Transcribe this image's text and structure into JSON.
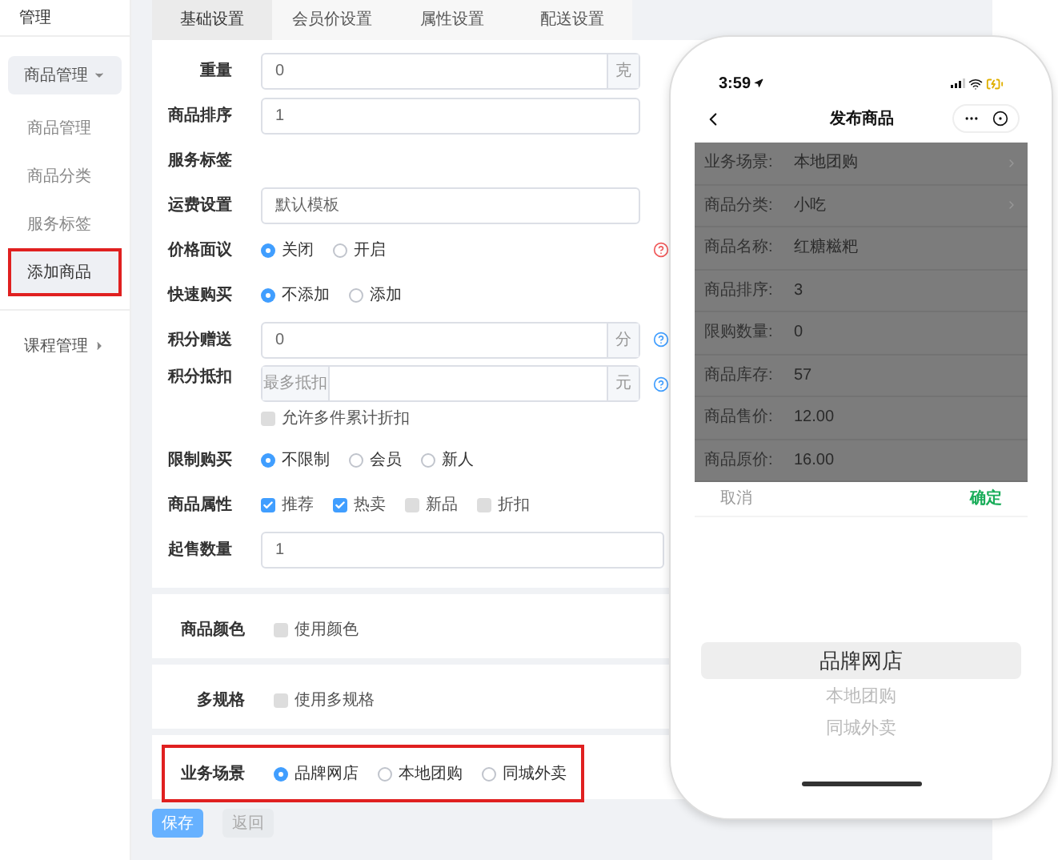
{
  "sidebar": {
    "title": "管理",
    "groups": [
      {
        "label": "商品管理",
        "expanded": true,
        "children": [
          {
            "label": "商品管理",
            "selected": false,
            "highlighted": false
          },
          {
            "label": "商品分类",
            "selected": false,
            "highlighted": false
          },
          {
            "label": "服务标签",
            "selected": false,
            "highlighted": false
          },
          {
            "label": "添加商品",
            "selected": true,
            "highlighted": true
          }
        ]
      },
      {
        "label": "课程管理",
        "expanded": false
      }
    ]
  },
  "tabs": [
    {
      "label": "基础设置",
      "selected": true
    },
    {
      "label": "会员价设置",
      "selected": false
    },
    {
      "label": "属性设置",
      "selected": false
    },
    {
      "label": "配送设置",
      "selected": false
    }
  ],
  "form_rows": [
    {
      "kind": "input",
      "label": "重量",
      "value": "0",
      "suffix": "克"
    },
    {
      "kind": "input",
      "label": "商品排序",
      "value": "1"
    },
    {
      "kind": "empty",
      "label": "服务标签"
    },
    {
      "kind": "input",
      "label": "运费设置",
      "value": "默认模板"
    },
    {
      "kind": "radio",
      "label": "价格面议",
      "help": {
        "color": "#f0595a"
      },
      "options": [
        {
          "label": "关闭",
          "selected": true
        },
        {
          "label": "开启",
          "selected": false
        }
      ]
    },
    {
      "kind": "radio",
      "label": "快速购买",
      "options": [
        {
          "label": "不添加",
          "selected": true
        },
        {
          "label": "添加",
          "selected": false
        }
      ]
    },
    {
      "kind": "input",
      "label": "积分赠送",
      "value": "0",
      "suffix": "分",
      "help": {
        "color": "#409eff"
      }
    },
    {
      "kind": "deduct",
      "label": "积分抵扣",
      "prefix": "最多抵扣",
      "suffix": "元",
      "help": {
        "color": "#409eff"
      },
      "checkbox": {
        "label": "允许多件累计折扣",
        "checked": false
      }
    },
    {
      "kind": "radio",
      "label": "限制购买",
      "options": [
        {
          "label": "不限制",
          "selected": true
        },
        {
          "label": "会员",
          "selected": false
        },
        {
          "label": "新人",
          "selected": false
        }
      ]
    },
    {
      "kind": "checks",
      "label": "商品属性",
      "options": [
        {
          "label": "推荐",
          "checked": true
        },
        {
          "label": "热卖",
          "checked": true
        },
        {
          "label": "新品",
          "checked": false
        },
        {
          "label": "折扣",
          "checked": false
        }
      ]
    },
    {
      "kind": "wide-input",
      "label": "起售数量",
      "value": "1"
    }
  ],
  "sections": [
    {
      "kind": "checks",
      "label": "商品颜色",
      "highlighted": false,
      "options": [
        {
          "label": "使用颜色",
          "checked": false
        }
      ]
    },
    {
      "kind": "checks",
      "label": "多规格",
      "highlighted": false,
      "options": [
        {
          "label": "使用多规格",
          "checked": false
        }
      ]
    },
    {
      "kind": "radio",
      "label": "业务场景",
      "highlighted": true,
      "options": [
        {
          "label": "品牌网店",
          "selected": true
        },
        {
          "label": "本地团购",
          "selected": false
        },
        {
          "label": "同城外卖",
          "selected": false
        }
      ]
    }
  ],
  "buttons": [
    {
      "label": "保存",
      "disabled": false
    },
    {
      "label": "返回",
      "disabled": true
    }
  ],
  "phone": {
    "time": "3:59",
    "title": "发布商品",
    "rows": [
      {
        "label": "业务场景:",
        "value": "本地团购",
        "arrow": true
      },
      {
        "label": "商品分类:",
        "value": "小吃",
        "arrow": true
      },
      {
        "label": "商品名称:",
        "value": "红糖糍粑",
        "arrow": false
      },
      {
        "label": "商品排序:",
        "value": "3",
        "arrow": false
      },
      {
        "label": "限购数量:",
        "value": "0",
        "arrow": false
      },
      {
        "label": "商品库存:",
        "value": "57",
        "arrow": false
      },
      {
        "label": "商品售价:",
        "value": "12.00",
        "arrow": false
      },
      {
        "label": "商品原价:",
        "value": "16.00",
        "arrow": false
      }
    ],
    "cancel": "取消",
    "confirm": "确定",
    "picker": [
      {
        "label": "品牌网店",
        "selected": true
      },
      {
        "label": "本地团购",
        "selected": false
      },
      {
        "label": "同城外卖",
        "selected": false
      }
    ]
  }
}
